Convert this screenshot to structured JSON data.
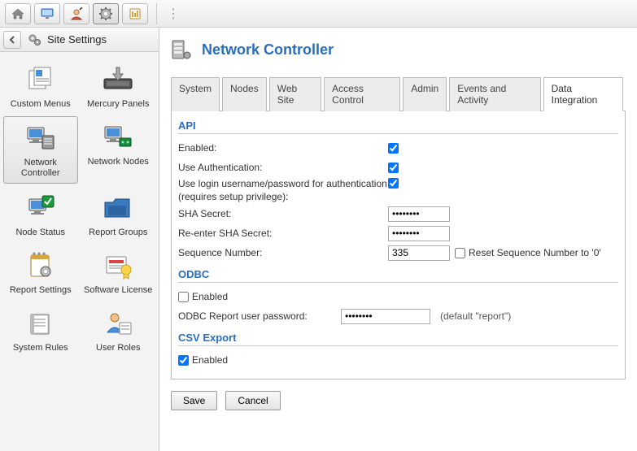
{
  "topbar": {
    "buttons": [
      "home",
      "monitor",
      "user-wizard",
      "gear",
      "report"
    ],
    "active_index": 3
  },
  "sidebar": {
    "title": "Site Settings",
    "items": [
      {
        "label": "Custom Menus",
        "icon": "menus"
      },
      {
        "label": "Mercury Panels",
        "icon": "panel-screw"
      },
      {
        "label": "Network Controller",
        "icon": "server-monitor",
        "selected": true
      },
      {
        "label": "Network Nodes",
        "icon": "nodes"
      },
      {
        "label": "Node Status",
        "icon": "node-status"
      },
      {
        "label": "Report Groups",
        "icon": "folder-chart"
      },
      {
        "label": "Report Settings",
        "icon": "notebook-gear"
      },
      {
        "label": "Software License",
        "icon": "license"
      },
      {
        "label": "System Rules",
        "icon": "rules"
      },
      {
        "label": "User Roles",
        "icon": "user-roles"
      }
    ]
  },
  "page": {
    "title": "Network Controller"
  },
  "tabs": [
    "System",
    "Nodes",
    "Web Site",
    "Access Control",
    "Admin",
    "Events and Activity",
    "Data Integration"
  ],
  "active_tab_index": 6,
  "api_section": {
    "title": "API",
    "enabled_label": "Enabled:",
    "enabled": true,
    "use_auth_label": "Use Authentication:",
    "use_auth": true,
    "login_label": "Use login username/password for authentication (requires setup privilege):",
    "login_checked": true,
    "sha_label": "SHA Secret:",
    "sha_value": "••••••••",
    "sha2_label": "Re-enter SHA Secret:",
    "sha2_value": "••••••••",
    "seq_label": "Sequence Number:",
    "seq_value": "335",
    "reset_label": "Reset Sequence Number to '0'",
    "reset_checked": false
  },
  "odbc_section": {
    "title": "ODBC",
    "enabled_label": "Enabled",
    "enabled": false,
    "pwd_label": "ODBC Report user password:",
    "pwd_value": "••••••••",
    "pwd_hint": "(default \"report\")"
  },
  "csv_section": {
    "title": "CSV Export",
    "enabled_label": "Enabled",
    "enabled": true
  },
  "buttons": {
    "save": "Save",
    "cancel": "Cancel"
  }
}
